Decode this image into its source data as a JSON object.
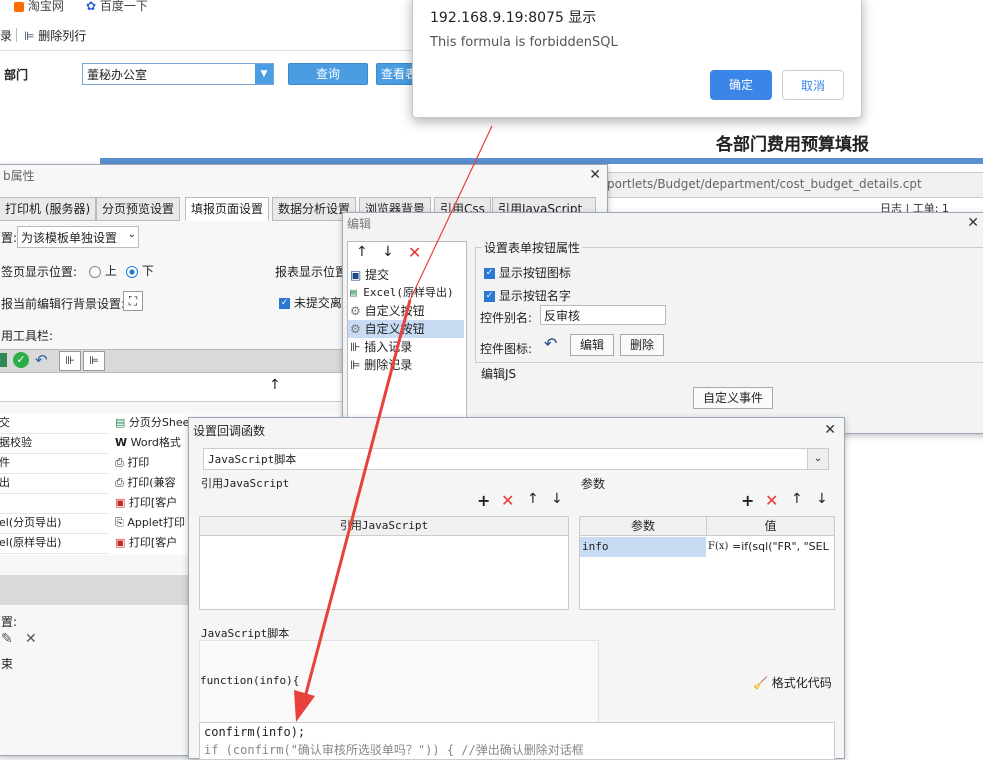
{
  "browser": {
    "bookmarks": [
      "淘宝网",
      "百度一下"
    ],
    "toolbar_left": "录",
    "delete_row_label": "删除列行"
  },
  "form": {
    "dept_label": "部门",
    "dept_value": "董秘办公室",
    "query_label": "查询",
    "view_label": "查看表"
  },
  "report": {
    "title": "各部门费用预算填报",
    "path": "portlets/Budget/department/cost_budget_details.cpt",
    "right_status": "日志 | 工单: 1"
  },
  "alert": {
    "origin": "192.168.9.19:8075 显示",
    "message": "This formula is forbiddenSQL",
    "ok_label": "确定",
    "cancel_label": "取消"
  },
  "web_props": {
    "title": "b属性",
    "tabs": [
      "打印机 (服务器)",
      "分页预览设置",
      "填报页面设置",
      "数据分析设置",
      "浏览器背景",
      "引用Css",
      "引用JavaScript"
    ],
    "setting_label": "置:",
    "setting_value": "为该模板单独设置",
    "tab_pos_label": "签页显示位置:",
    "pos_up": "上",
    "pos_down": "下",
    "report_pos_label": "报表显示位置",
    "edit_bg_label": "报当前编辑行背景设置:",
    "unsubmitted_label": "未提交离",
    "toolbar_label": "用工具栏:",
    "grid_rows_left": [
      "交",
      "据校验",
      "件",
      "出",
      "",
      "el(分页导出)",
      "el(原样导出)"
    ],
    "grid_rows_mid": [
      "分页分Sheet",
      "Word格式",
      "打印",
      "打印(兼容",
      "打印[客户",
      "Applet打印",
      "打印[客户"
    ],
    "bottom_label": "置:",
    "bottom_item": "束"
  },
  "edit_dialog": {
    "title": "编辑",
    "items": [
      "提交",
      "Excel(原样导出)",
      "自定义按钮",
      "自定义按钮",
      "插入记录",
      "删除记录"
    ],
    "props_title": "设置表单按钮属性",
    "show_icon": "显示按钮图标",
    "show_name": "显示按钮名字",
    "alias_label": "控件别名:",
    "alias_value": "反审核",
    "icon_label": "控件图标:",
    "edit_btn": "编辑",
    "delete_btn": "删除",
    "js_section": "编辑JS",
    "custom_event": "自定义事件"
  },
  "callback_dialog": {
    "title": "设置回调函数",
    "type_value": "JavaScript脚本",
    "ref_js_label": "引用JavaScript",
    "ref_js_header": "引用JavaScript",
    "params_label": "参数",
    "param_col": "参数",
    "value_col": "值",
    "param_name": "info",
    "fx_label": "F(x)",
    "param_value": "=if(sql(\"FR\", \"SEL",
    "script_label": "JavaScript脚本",
    "function_sig": "function(info){",
    "format_label": "格式化代码",
    "code_line1": "confirm(info);",
    "code_line2": "if (confirm(\"确认审核所选驳单吗？\")) {   //弹出确认删除对话框"
  },
  "colors": {
    "accent": "#4a9de0",
    "report_bar": "#5a8fd0",
    "arrow": "#e8413c",
    "selection": "#c7dcf3"
  }
}
